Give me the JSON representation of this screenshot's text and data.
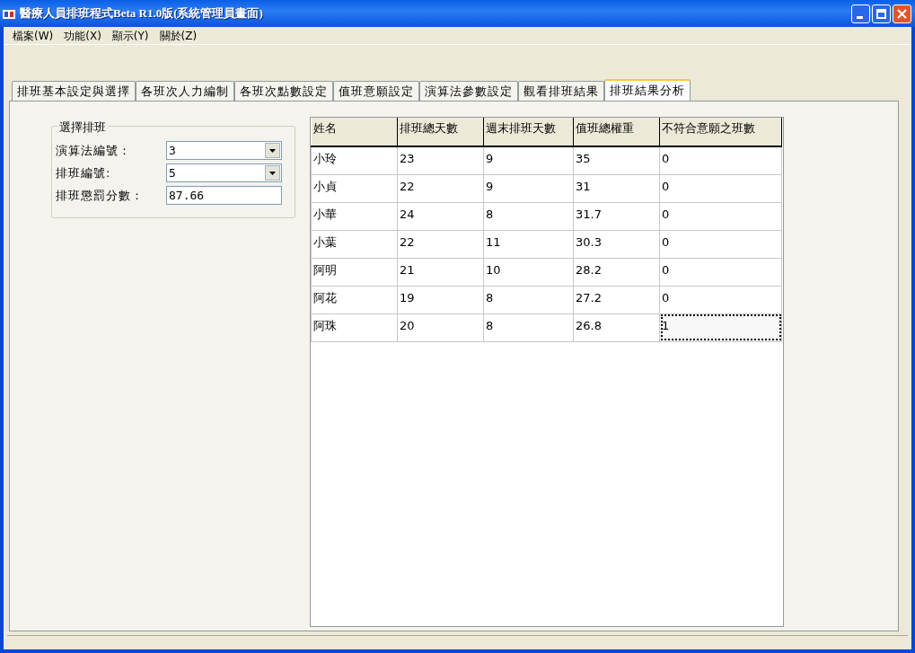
{
  "window": {
    "title": "醫療人員排班程式Beta R1.0版(系統管理員畫面)"
  },
  "menu": [
    "檔案(W)",
    "功能(X)",
    "顯示(Y)",
    "關於(Z)"
  ],
  "tabs": [
    {
      "label": "排班基本設定與選擇",
      "selected": false
    },
    {
      "label": "各班次人力編制",
      "selected": false
    },
    {
      "label": "各班次點數設定",
      "selected": false
    },
    {
      "label": "值班意願設定",
      "selected": false
    },
    {
      "label": "演算法參數設定",
      "selected": false
    },
    {
      "label": "觀看排班結果",
      "selected": false
    },
    {
      "label": "排班結果分析",
      "selected": true
    }
  ],
  "group": {
    "title": "選擇排班",
    "fields": [
      {
        "kind": "combo",
        "label": "演算法編號：",
        "value": "3"
      },
      {
        "kind": "combo",
        "label": "排班編號:",
        "value": "5"
      },
      {
        "kind": "text",
        "label": "排班懲罰分數：",
        "value": "87.66"
      }
    ]
  },
  "table": {
    "columns": [
      "姓名",
      "排班總天數",
      "週末排班天數",
      "值班總權重",
      "不符合意願之班數"
    ],
    "rows": [
      {
        "cells": [
          "小玲",
          "23",
          "9",
          "35",
          "0"
        ],
        "focused": false
      },
      {
        "cells": [
          "小貞",
          "22",
          "9",
          "31",
          "0"
        ],
        "focused": false
      },
      {
        "cells": [
          "小華",
          "24",
          "8",
          "31.7",
          "0"
        ],
        "focused": false
      },
      {
        "cells": [
          "小葉",
          "22",
          "11",
          "30.3",
          "0"
        ],
        "focused": false
      },
      {
        "cells": [
          "阿明",
          "21",
          "10",
          "28.2",
          "0"
        ],
        "focused": false
      },
      {
        "cells": [
          "阿花",
          "19",
          "8",
          "27.2",
          "0"
        ],
        "focused": false
      },
      {
        "cells": [
          "阿珠",
          "20",
          "8",
          "26.8",
          "1"
        ],
        "focused": true
      }
    ]
  }
}
